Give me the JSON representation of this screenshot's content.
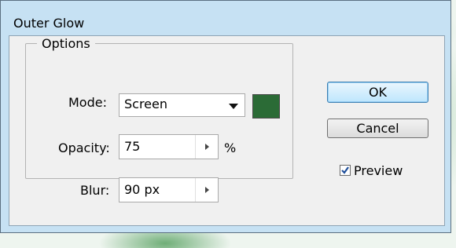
{
  "dialog": {
    "title": "Outer Glow"
  },
  "options": {
    "legend": "Options",
    "mode": {
      "label": "Mode:",
      "value": "Screen"
    },
    "glow_color": "#2b6b36",
    "opacity": {
      "label": "Opacity:",
      "value": "75",
      "unit": "%"
    },
    "blur": {
      "label": "Blur:",
      "value": "90 px"
    }
  },
  "buttons": {
    "ok": "OK",
    "cancel": "Cancel"
  },
  "preview": {
    "label": "Preview",
    "checked": true
  },
  "icons": {
    "dropdown": "chevron-down-icon",
    "stepper": "triangle-right-icon",
    "check": "checkmark-icon"
  }
}
